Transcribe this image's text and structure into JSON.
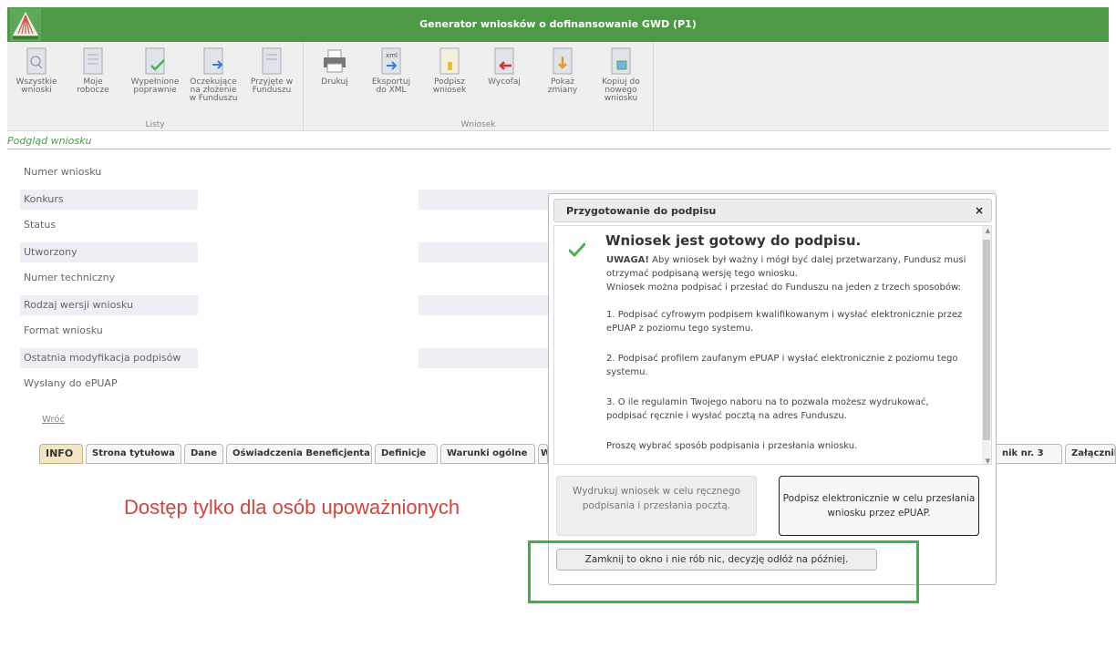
{
  "app": {
    "title": "Generator wniosków o dofinansowanie GWD (P1)"
  },
  "toolbar": {
    "groups": [
      {
        "label": "Listy",
        "buttons": [
          "Wszystkie\nwnioski",
          "Moje\nrobocze",
          "Wypełnione\npoprawnie",
          "Oczekujące\nna złożenie\nw Funduszu",
          "Przyjęte w\nFunduszu"
        ]
      },
      {
        "label": "Wniosek",
        "buttons": [
          "Drukuj",
          "Eksportuj\ndo XML",
          "Podpisz\nwniosek",
          "Wycofaj",
          "Pokaż\nzmiany",
          "Kopiuj do\nnowego\nwniosku"
        ]
      }
    ]
  },
  "preview": {
    "title": "Podgląd wniosku",
    "fields": [
      "Numer wniosku",
      "Konkurs",
      "Status",
      "Utworzony",
      "Numer techniczny",
      "Rodzaj wersji wniosku",
      "Format wniosku",
      "Ostatnia modyfikacja podpisów",
      "Wysłany do ePUAP"
    ],
    "back_label": "Wróć"
  },
  "tabs": [
    "INFO",
    "Strona tytułowa",
    "Dane",
    "Oświadczenia Beneficjenta",
    "Definicje",
    "Warunki ogólne",
    "W",
    "nik nr. 3",
    "Załącznik nr"
  ],
  "notice": "Dostęp tylko dla osób upoważnionych",
  "dialog": {
    "title": "Przygotowanie do podpisu",
    "close": "×",
    "heading": "Wniosek jest gotowy do podpisu.",
    "warning_label": "UWAGA!",
    "warning_text": " Aby wniosek był ważny i mógł być dalej przetwarzany, Fundusz musi otrzymać podpisaną wersję tego wniosku.",
    "line2": "Wniosek można podpisać i przesłać do Funduszu na jeden z trzech sposobów:",
    "option1": "1. Podpisać cyfrowym podpisem kwalifikowanym i wysłać elektronicznie przez ePUAP z poziomu tego systemu.",
    "option2": "2. Podpisać profilem zaufanym ePUAP i wysłać elektronicznie z poziomu tego systemu.",
    "option3": "3. O ile regulamin Twojego naboru na to pozwala możesz wydrukować, podpisać ręcznie i wysłać pocztą na adres Funduszu.",
    "prompt": "Proszę wybrać sposób podpisania i przesłania wniosku.",
    "btn_print": "Wydrukuj wniosek w celu ręcznego podpisania i przesłania pocztą.",
    "btn_sign": "Podpisz elektronicznie w celu przesłania wniosku przez ePUAP.",
    "btn_close": "Zamknij to okno i nie rób nic, decyzję odłóż na później."
  },
  "colors": {
    "titlebar": "#4c9a45",
    "notice": "#d0453c",
    "highlight": "#3fb04a"
  }
}
